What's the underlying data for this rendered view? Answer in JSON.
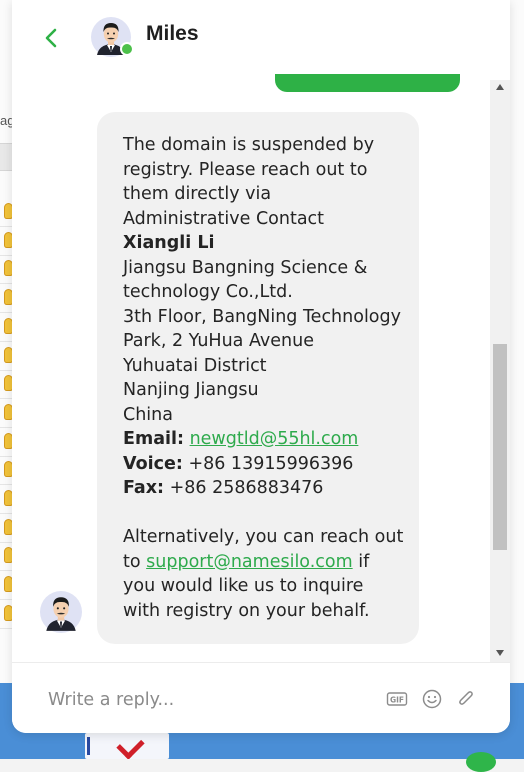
{
  "background": {
    "partial_text": "ag"
  },
  "header": {
    "agent_name": "Miles",
    "status": "online"
  },
  "message": {
    "intro_lines": [
      "The domain is suspended by",
      "registry. Please reach out to",
      "them directly via",
      "Administrative Contact"
    ],
    "contact_name": "Xiangli Li",
    "address_lines": [
      "Jiangsu Bangning Science &",
      "technology Co.,Ltd.",
      "3th Floor, BangNing Technology",
      "Park, 2 YuHua Avenue",
      "Yuhuatai District",
      "Nanjing Jiangsu",
      "China"
    ],
    "email_label": "Email:",
    "email": "newgtld@55hl.com",
    "voice_label": "Voice:",
    "voice": "+86 13915996396",
    "fax_label": "Fax:",
    "fax": "+86 2586883476",
    "alt_line1": "Alternatively, you can reach out",
    "alt_to": "to ",
    "support_email": "support@namesilo.com",
    "alt_if": " if",
    "alt_line3": "you would like us to inquire",
    "alt_line4": "with registry on your behalf."
  },
  "composer": {
    "placeholder": "Write a reply...",
    "gif_label": "GIF"
  },
  "colors": {
    "accent": "#2eb146",
    "link": "#2eaa4c",
    "bubble": "#f1f1f1",
    "online": "#4cc04a"
  }
}
